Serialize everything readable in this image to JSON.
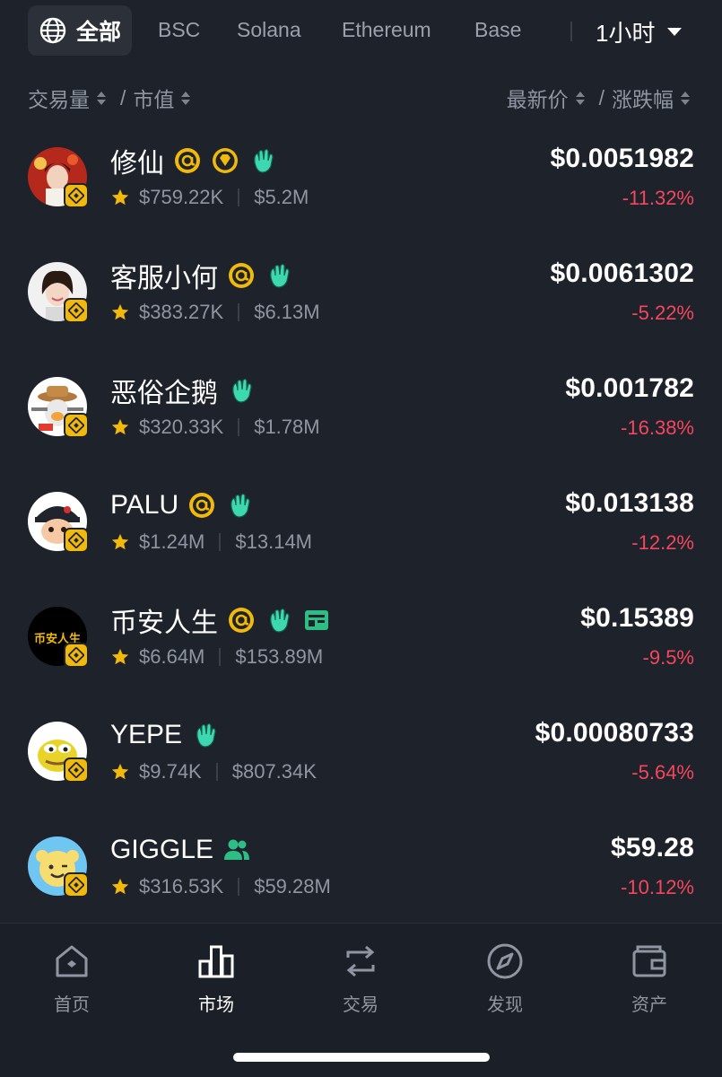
{
  "chain_tabs": {
    "all_label": "全部",
    "tabs": [
      "BSC",
      "Solana",
      "Ethereum",
      "Base"
    ],
    "timeframe": "1小时"
  },
  "sort_header": {
    "volume": "交易量",
    "slash": "/",
    "market_cap": "市值",
    "latest_price": "最新价",
    "change": "涨跌幅"
  },
  "tokens": [
    {
      "name": "修仙",
      "volume": "$759.22K",
      "market_cap": "$5.2M",
      "price": "$0.0051982",
      "change": "-11.32%",
      "tags": [
        "at-icon",
        "gem-icon",
        "wave-icon"
      ]
    },
    {
      "name": "客服小何",
      "volume": "$383.27K",
      "market_cap": "$6.13M",
      "price": "$0.0061302",
      "change": "-5.22%",
      "tags": [
        "at-icon",
        "wave-icon"
      ]
    },
    {
      "name": "恶俗企鹅",
      "volume": "$320.33K",
      "market_cap": "$1.78M",
      "price": "$0.001782",
      "change": "-16.38%",
      "tags": [
        "wave-icon"
      ]
    },
    {
      "name": "PALU",
      "volume": "$1.24M",
      "market_cap": "$13.14M",
      "price": "$0.013138",
      "change": "-12.2%",
      "tags": [
        "at-icon",
        "wave-icon"
      ]
    },
    {
      "name": "币安人生",
      "volume": "$6.64M",
      "market_cap": "$153.89M",
      "price": "$0.15389",
      "change": "-9.5%",
      "tags": [
        "at-icon",
        "wave-icon",
        "wallet-card-icon"
      ],
      "avatar_text": "币安人生"
    },
    {
      "name": "YEPE",
      "volume": "$9.74K",
      "market_cap": "$807.34K",
      "price": "$0.00080733",
      "change": "-5.64%",
      "tags": [
        "wave-icon"
      ]
    },
    {
      "name": "GIGGLE",
      "volume": "$316.53K",
      "market_cap": "$59.28M",
      "price": "$59.28",
      "change": "-10.12%",
      "tags": [
        "users-icon"
      ]
    }
  ],
  "bottom_nav": {
    "items": [
      {
        "label": "首页",
        "icon": "home-icon"
      },
      {
        "label": "市场",
        "icon": "bar-chart-icon",
        "active": true
      },
      {
        "label": "交易",
        "icon": "swap-icon"
      },
      {
        "label": "发现",
        "icon": "compass-icon"
      },
      {
        "label": "资产",
        "icon": "wallet-icon"
      }
    ]
  },
  "colors": {
    "background": "#1e222b",
    "negative": "#f6465d",
    "accent_yellow": "#f0b90b",
    "tag_green": "#2ebd85",
    "tag_wave": "#3cd9b0"
  }
}
